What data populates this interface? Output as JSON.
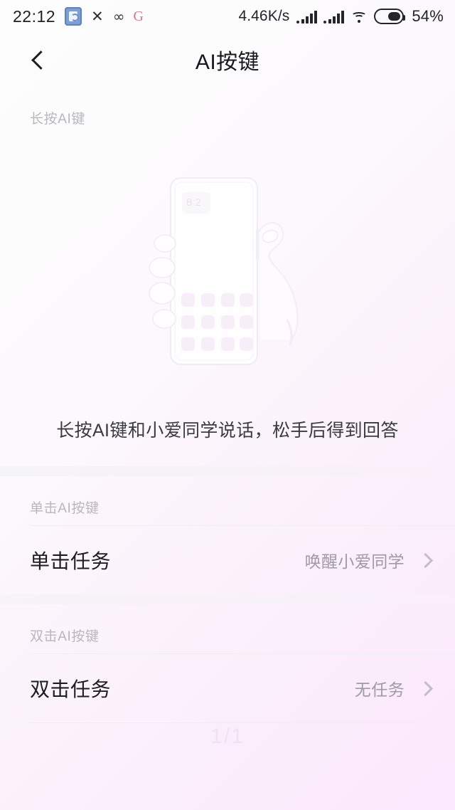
{
  "status_bar": {
    "time": "22:12",
    "icons_left": [
      "app-icon",
      "close-icon",
      "infinity-icon",
      "google-icon"
    ],
    "network_speed": "4.46K/s",
    "icons_right": [
      "signal-icon",
      "signal-icon",
      "wifi-icon",
      "battery-icon"
    ],
    "battery_percent": "54%"
  },
  "header": {
    "back_icon": "chevron-left-icon",
    "title": "AI按键"
  },
  "long_press_section": {
    "section_label": "长按AI键",
    "illustration": "hand-holding-phone-pressing-side-button",
    "caption": "长按AI键和小爱同学说话，松手后得到回答"
  },
  "single_click_section": {
    "section_label": "单击AI按键",
    "row": {
      "label": "单击任务",
      "value": "唤醒小爱同学",
      "chevron": "chevron-right-icon"
    }
  },
  "double_click_section": {
    "section_label": "双击AI按键",
    "row": {
      "label": "双击任务",
      "value": "无任务",
      "chevron": "chevron-right-icon"
    }
  },
  "footer": {
    "page_indicator": "1/1"
  },
  "colors": {
    "background_start": "#fdfdfd",
    "background_end": "#fbe9fd",
    "primary_text": "#1d1e23",
    "secondary_text": "#9f9aa6",
    "section_label": "#b9b6bd",
    "divider": "#f0eef2"
  }
}
